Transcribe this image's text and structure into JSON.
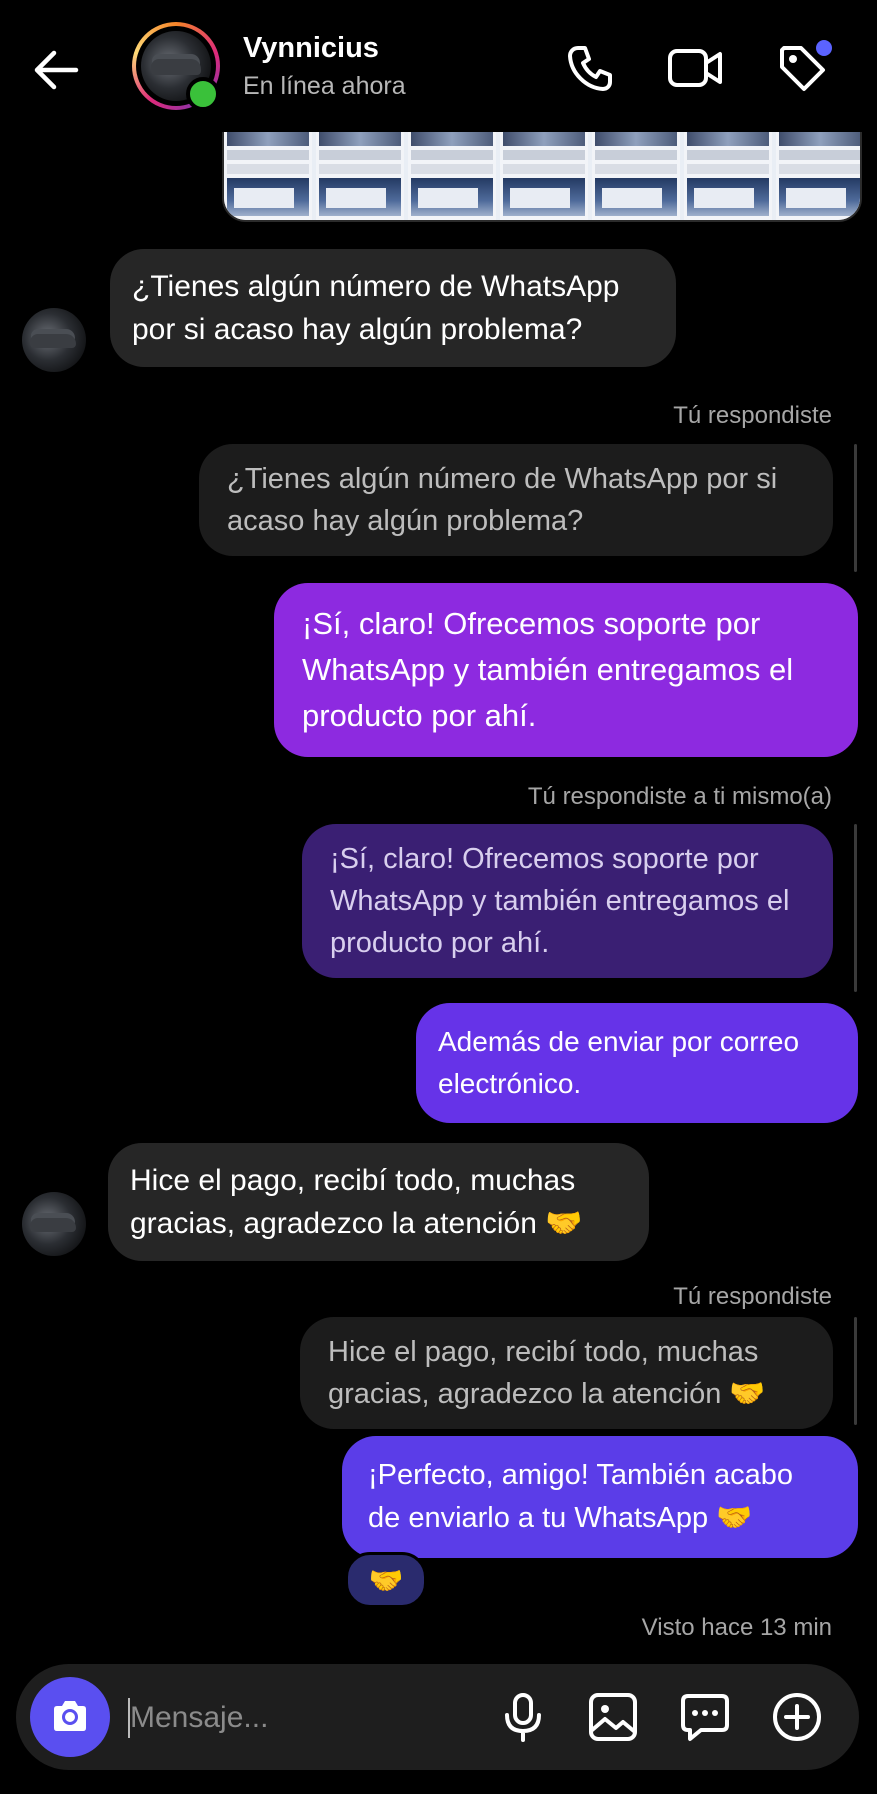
{
  "header": {
    "name": "Vynnicius",
    "status": "En línea ahora"
  },
  "messages": {
    "m1": "¿Tienes algún número de WhatsApp por si acaso hay algún problema?",
    "meta1": "Tú respondiste",
    "reply1": "¿Tienes algún número de WhatsApp por si acaso hay algún problema?",
    "out1": "¡Sí, claro! Ofrecemos soporte por WhatsApp y también entregamos el producto por ahí.",
    "meta2": "Tú respondiste a ti mismo(a)",
    "reply2": "¡Sí, claro! Ofrecemos soporte por WhatsApp y también entregamos el producto por ahí.",
    "out2": "Además de enviar por correo electrónico.",
    "m2": "Hice el pago, recibí todo, muchas gracias, agradezco la atención 🤝",
    "meta3": "Tú respondiste",
    "reply3": "Hice el pago, recibí todo, muchas gracias, agradezco la atención 🤝",
    "out3": "¡Perfecto, amigo! También acabo de enviarlo a tu WhatsApp 🤝",
    "reaction": "🤝",
    "seen": "Visto hace 13 min"
  },
  "composer": {
    "placeholder": "Mensaje..."
  },
  "colors": {
    "accent": "#5a4ff0",
    "online": "#3ac13a",
    "out_bubble_1": "#8d2ae0",
    "out_bubble_2": "#6633e8",
    "out_bubble_3": "#5b3de8"
  },
  "icons": [
    "back-arrow-icon",
    "phone-icon",
    "video-icon",
    "tag-icon",
    "camera-icon",
    "microphone-icon",
    "gallery-icon",
    "sticker-chat-icon",
    "add-circle-icon"
  ]
}
